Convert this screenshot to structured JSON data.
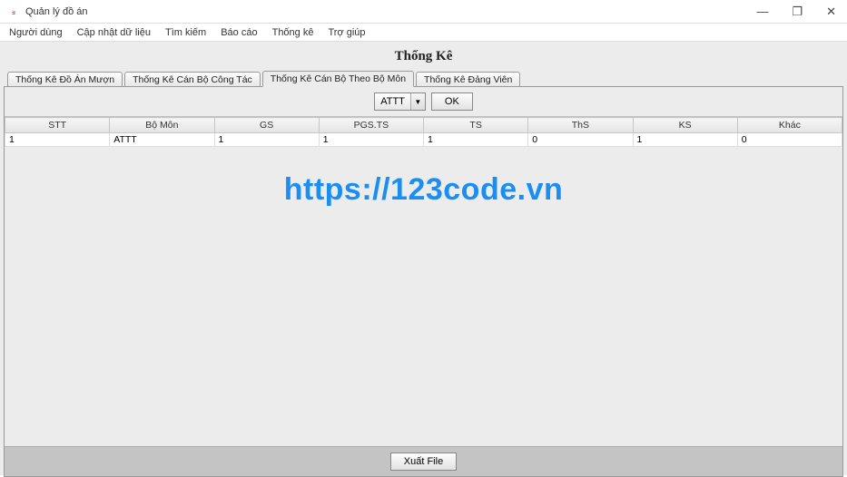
{
  "window": {
    "title": "Quản lý đồ án"
  },
  "menus": [
    "Người dùng",
    "Cập nhật dữ liệu",
    "Tìm kiếm",
    "Báo cáo",
    "Thống kê",
    "Trợ giúp"
  ],
  "page": {
    "heading": "Thống Kê"
  },
  "tabs": [
    {
      "label": "Thống Kê Đồ Án Mượn"
    },
    {
      "label": "Thống Kê Cán Bộ Công Tác"
    },
    {
      "label": "Thống Kê Cán Bộ Theo Bộ Môn"
    },
    {
      "label": "Thống Kê Đảng Viên"
    }
  ],
  "filter": {
    "selected": "ATTT",
    "ok_label": "OK"
  },
  "table": {
    "columns": [
      "STT",
      "Bộ Môn",
      "GS",
      "PGS.TS",
      "TS",
      "ThS",
      "KS",
      "Khác"
    ],
    "rows": [
      {
        "stt": "1",
        "bomon": "ATTT",
        "gs": "1",
        "pgsts": "1",
        "ts": "1",
        "ths": "0",
        "ks": "1",
        "khac": "0"
      }
    ]
  },
  "watermark": "https://123code.vn",
  "footer": {
    "export_label": "Xuất File"
  }
}
